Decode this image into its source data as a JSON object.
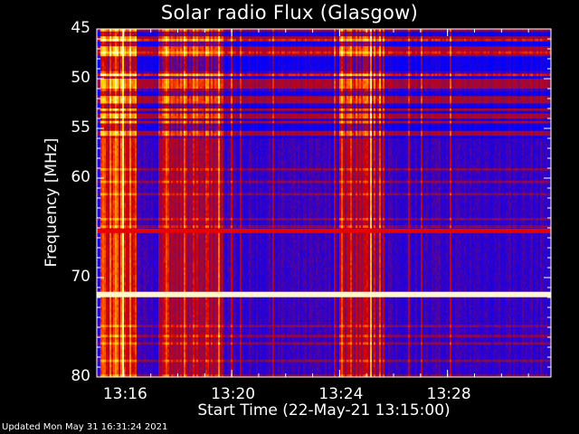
{
  "chart_data": {
    "type": "heatmap",
    "title": "Solar radio Flux (Glasgow)",
    "xlabel": "Start Time (22-May-21 13:15:00)",
    "ylabel": "Frequency [MHz]",
    "x_unit": "time (UT)",
    "xlim": [
      "13:15:00",
      "13:31:50"
    ],
    "ylim": [
      45,
      80
    ],
    "y_reversed": true,
    "x_ticks": [
      "13:16",
      "13:20",
      "13:24",
      "13:28"
    ],
    "y_ticks": [
      45,
      50,
      55,
      60,
      70,
      80
    ],
    "colormap": [
      "#0000ff",
      "#3000c8",
      "#8a0a50",
      "#d40000",
      "#ff6000",
      "#ffd000",
      "#ffffc0"
    ],
    "features": {
      "persistent_interference_bands_mhz": [
        65.3,
        71.7
      ],
      "burst_activity_times": [
        "13:15:10-13:16:30",
        "13:17:15-13:19:40",
        "13:24:00-13:25:40"
      ],
      "saturated_upper_band_mhz": [
        45,
        56
      ]
    }
  },
  "footer": {
    "updated_text": "Updated Mon May 31 16:31:24 2021"
  }
}
